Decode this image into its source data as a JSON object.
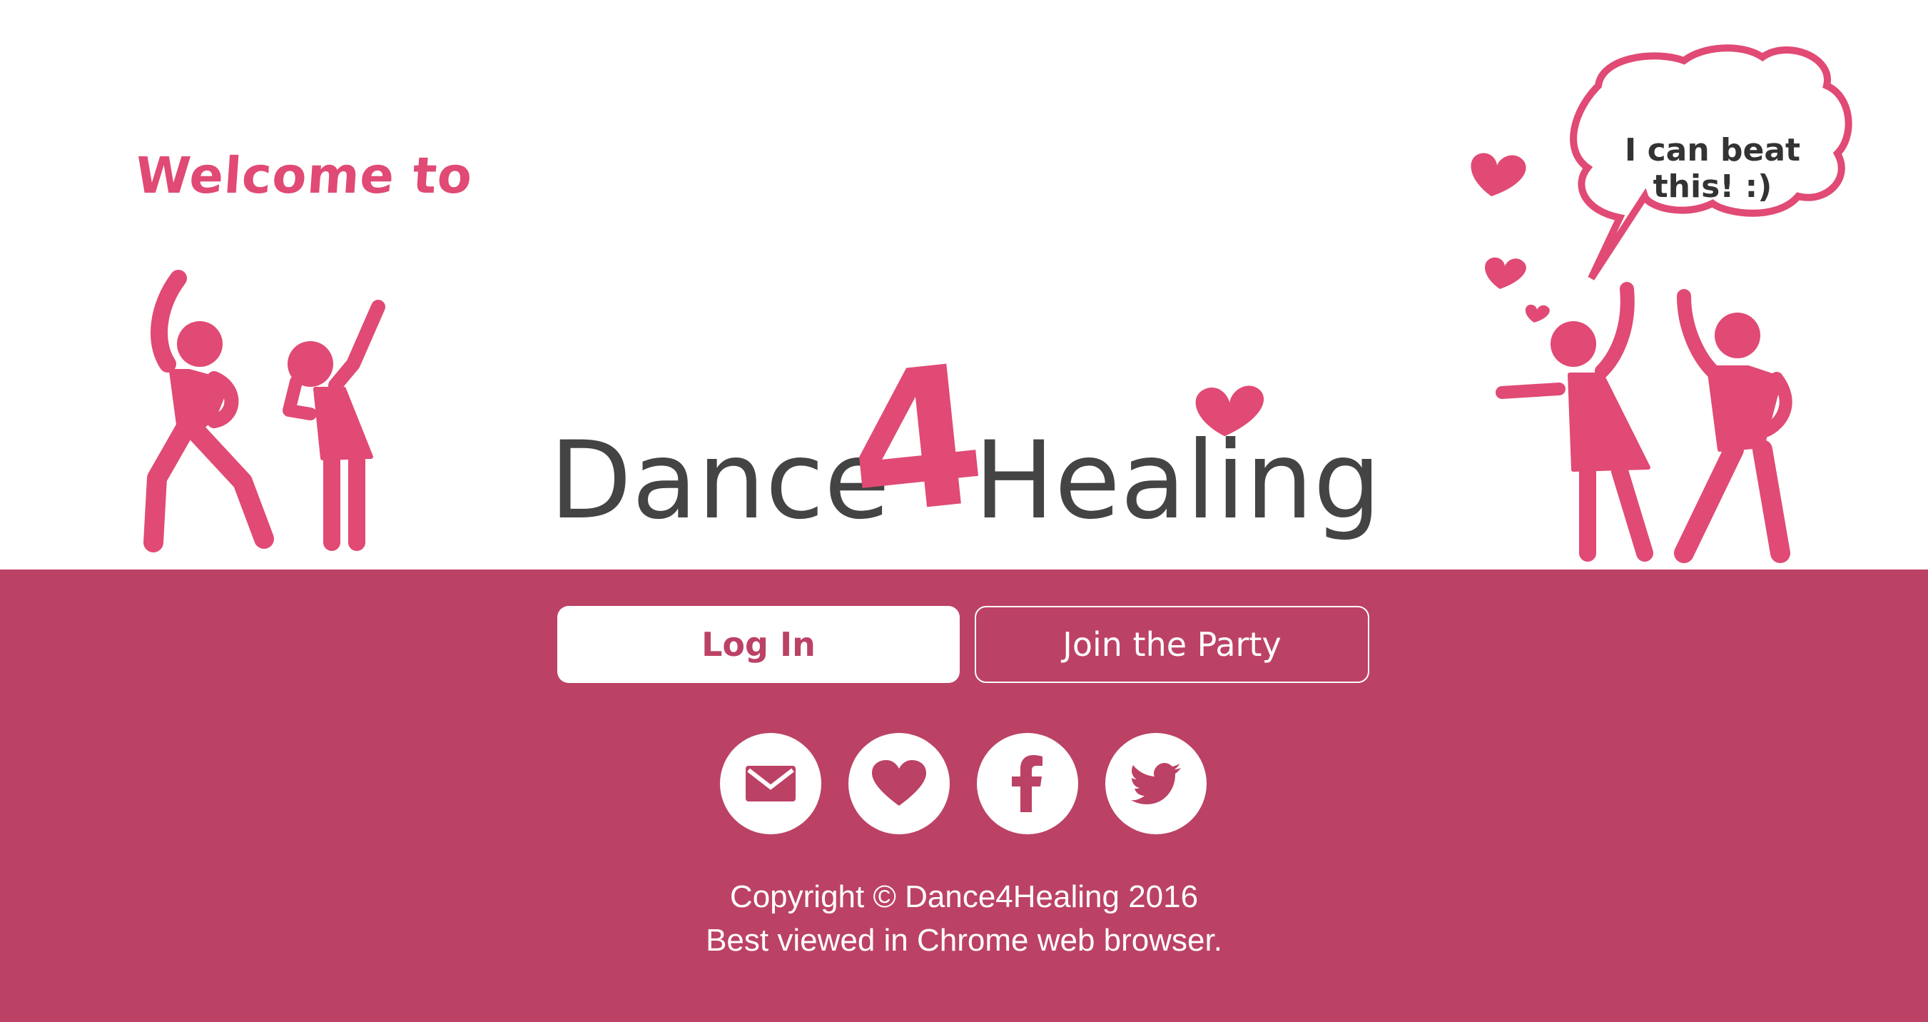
{
  "hero": {
    "welcome_text": "Welcome to",
    "brand": {
      "part1": "Dance",
      "number": "4",
      "part2": "Healing"
    },
    "speech_bubble_text": "I can beat this! :)"
  },
  "actions": {
    "login_label": "Log In",
    "join_label": "Join the Party"
  },
  "social": [
    {
      "name": "email",
      "icon": "envelope-icon"
    },
    {
      "name": "donate",
      "icon": "heart-icon"
    },
    {
      "name": "facebook",
      "icon": "facebook-icon"
    },
    {
      "name": "twitter",
      "icon": "twitter-icon"
    }
  ],
  "footer": {
    "copyright": "Copyright © Dance4Healing 2016",
    "note": "Best viewed in Chrome web browser."
  },
  "colors": {
    "accent": "#e04a74",
    "band": "#bb4265",
    "logo_text": "#444444"
  }
}
